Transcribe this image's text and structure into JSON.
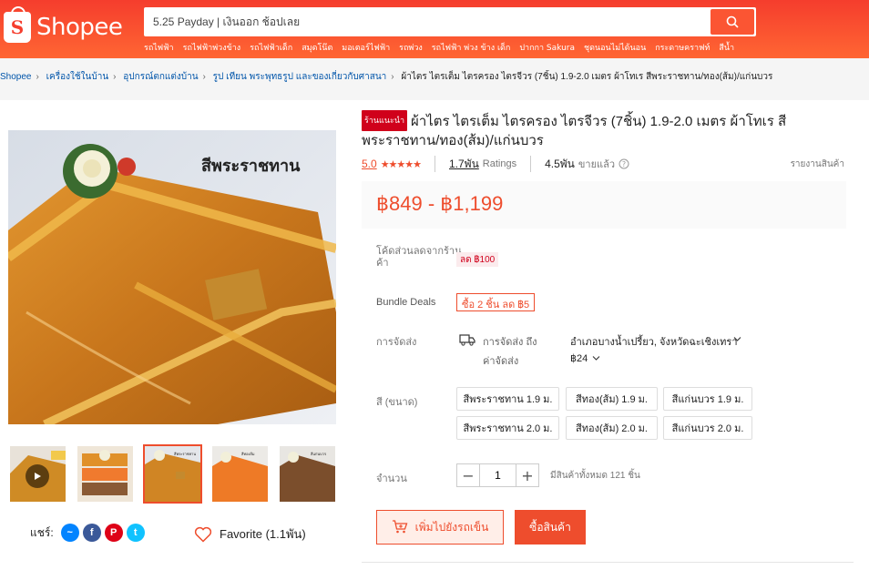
{
  "header": {
    "logo_text": "Shopee",
    "logo_letter": "S",
    "search_value": "5.25 Payday | เงินออก ช้อปเลย",
    "hot_words": [
      "รถไฟฟ้า",
      "รถไฟฟ้าพ่วงข้าง",
      "รถไฟฟ้าเด็ก",
      "สมุดโน๊ต",
      "มอเตอร์ไฟฟ้า",
      "รถพ่วง",
      "รถไฟฟ้า พ่วง ข้าง เด็ก",
      "ปากกา Sakura",
      "ชุดนอนไม่ได้นอน",
      "กระดาษคราฟท์",
      "สีน้ำ"
    ]
  },
  "breadcrumb": [
    "Shopee",
    "เครื่องใช้ในบ้าน",
    "อุปกรณ์ตกแต่งบ้าน",
    "รูป เทียน พระพุทธรูป และของเกี่ยวกับศาสนา",
    "ผ้าไตร ไตรเต็ม ไตรครอง ไตรจีวร (7ชิ้น) 1.9-2.0 เมตร ผ้าโทเร สีพระราชทาน/ทอง(ส้ม)/แก่นบวร"
  ],
  "product": {
    "badge": "ร้านแนะนำ",
    "title": "ผ้าไตร ไตรเต็ม ไตรครอง ไตรจีวร (7ชิ้น) 1.9-2.0 เมตร ผ้าโทเร สีพระราชทาน/ทอง(ส้ม)/แก่นบวร",
    "image_caption": "สีพระราชทาน",
    "rating": "5.0",
    "stars": "★★★★★",
    "ratings_count": "1.7พัน",
    "ratings_label": "Ratings",
    "sold_count": "4.5พัน",
    "sold_label": "ขายแล้ว",
    "report": "รายงานสินค้า",
    "price": "฿849 - ฿1,199"
  },
  "details": {
    "voucher_label": "โค้ดส่วนลดจากร้านค้า",
    "voucher_line1": "โค้ดส่วนลดจากร้าน",
    "voucher_line2": "ค้า",
    "voucher_value": "ลด ฿100",
    "bundle_label": "Bundle Deals",
    "bundle_value": "ซื้อ 2 ชิ้น ลด ฿5",
    "shipping_label": "การจัดส่ง",
    "ship_to_label": "การจัดส่ง ถึง",
    "ship_to_value": "อำเภอบางน้ำเปรี้ยว, จังหวัดฉะเชิงเทรา",
    "ship_fee_label": "ค่าจัดส่ง",
    "ship_fee_value": "฿24",
    "variation_label": "สี (ขนาด)",
    "options": [
      "สีพระราชทาน 1.9 ม.",
      "สีทอง(ส้ม) 1.9 ม.",
      "สีแก่นบวร 1.9 ม.",
      "สีพระราชทาน 2.0 ม.",
      "สีทอง(ส้ม) 2.0 ม.",
      "สีแก่นบวร 2.0 ม."
    ],
    "quantity_label": "จำนวน",
    "quantity_value": "1",
    "stock": "มีสินค้าทั้งหมด 121 ชิ้น",
    "add_to_cart": "เพิ่มไปยังรถเข็น",
    "buy_now": "ซื้อสินค้า"
  },
  "gallery": {
    "thumb_captions": [
      "สีพระราชทาน",
      "สีทองส้ม",
      "สีแก่นบวร"
    ]
  },
  "social": {
    "share_label": "แชร์:",
    "favorite_label": "Favorite (1.1พัน)"
  },
  "colors": {
    "brand": "#ee4d2d",
    "header_start": "#f53d2d",
    "header_end": "#ff6633"
  }
}
